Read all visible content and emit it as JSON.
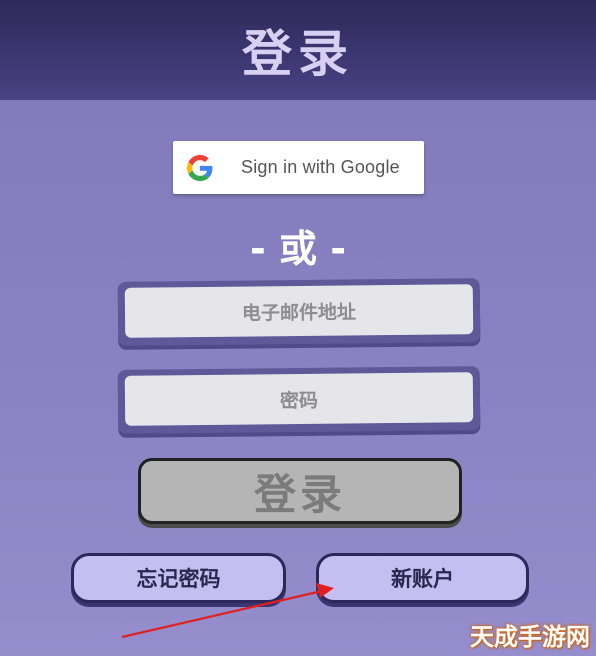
{
  "header": {
    "title": "登录"
  },
  "google": {
    "label": "Sign in with Google",
    "icon": "google-g-icon"
  },
  "divider": {
    "text": "- 或 -"
  },
  "form": {
    "email_placeholder": "电子邮件地址",
    "password_placeholder": "密码"
  },
  "login_button": {
    "label": "登录"
  },
  "footer": {
    "forgot_password_label": "忘记密码",
    "new_account_label": "新账户"
  },
  "watermark": {
    "text": "天成手游网"
  },
  "colors": {
    "header_bg": "#3d3772",
    "page_bg": "#8a82c2",
    "arrow": "#e02020",
    "button_fill": "#c4bff0",
    "login_button_fill": "#b5b5b5"
  }
}
